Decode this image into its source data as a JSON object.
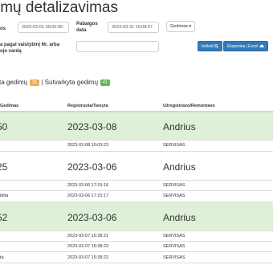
{
  "page_title": "imų detalizavimas",
  "filters": {
    "from_label": "os",
    "from_value": "2023-03-01 00:00:00",
    "to_label": "Pabaigos data",
    "to_value": "2023-03-31 10:08:07",
    "type_value": "Gedimas",
    "search_label": "a pagal valstybinį Nr. arba\nojo vardą",
    "search_value": "",
    "search_button": "Ieškoti",
    "export_button": "Eksportas į Excel"
  },
  "legend": {
    "text1": "ta gedimų",
    "badge1": "26",
    "separator": "|",
    "text2": "Sutvarkyta gedimų",
    "badge2": "41"
  },
  "table": {
    "headers": [
      "Gedimas",
      "Registruota/Taisyta",
      "Užregistravo/Remontavo"
    ],
    "groups": [
      {
        "id": "50",
        "date": "2023-03-08",
        "person": "Andrius",
        "highlight": true,
        "rows": [
          {
            "c1": "",
            "c2": "2023-03-08 10:03:23",
            "c3": "SERVISAS"
          }
        ]
      },
      {
        "id": "25",
        "date": "2023-03-06",
        "person": "Andrius",
        "highlight": false,
        "rows": [
          {
            "c1": "",
            "c2": "2023-03-06 17:15:16",
            "c3": "SERVISAS"
          },
          {
            "c1": "bitta",
            "c2": "2023-03-06 17:15:17",
            "c3": "SERVISAS"
          }
        ]
      },
      {
        "id": "52",
        "date": "2023-03-06",
        "person": "Andrius",
        "highlight": true,
        "rows": [
          {
            "c1": "",
            "c2": "2023-03-07 15:38:21",
            "c3": "SERVISAS"
          },
          {
            "c1": "",
            "c2": "2023-03-07 15:38:23",
            "c3": "SERVISAS"
          },
          {
            "c1": "ta",
            "c2": "2023-03-07 15:38:22",
            "c3": "SERVISAS"
          }
        ]
      }
    ]
  },
  "colors": {
    "primary": "#337ab7",
    "badge_orange": "#f0ad4e",
    "badge_green": "#5cb85c",
    "row_highlight": "#dff0d8"
  },
  "icons": {
    "search": "search-icon",
    "export": "cloud-upload-icon",
    "dropdown": "caret-down-icon"
  }
}
